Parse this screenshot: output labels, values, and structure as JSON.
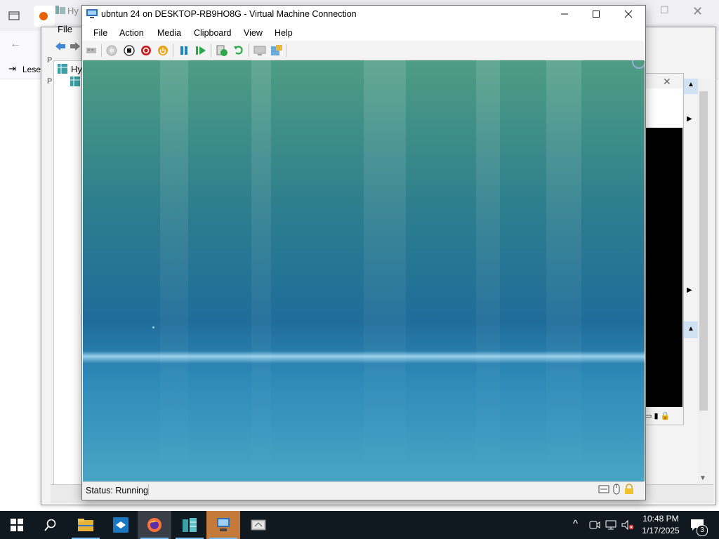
{
  "browser": {
    "bookmark_label": "Lesez",
    "tab_label": "Hy"
  },
  "hyperv_manager": {
    "menu_file": "File",
    "tree_root_label": "Hy",
    "pane_letter_1": "P",
    "pane_letter_2": "P"
  },
  "vm_window": {
    "title": "ubntun 24 on DESKTOP-RB9HO8G - Virtual Machine Connection",
    "menu": [
      "File",
      "Action",
      "Media",
      "Clipboard",
      "View",
      "Help"
    ],
    "status": "Status: Running"
  },
  "taskbar": {
    "time": "10:48 PM",
    "date": "1/17/2025",
    "notification_count": "3",
    "apps": [
      "file-explorer",
      "app-blue",
      "firefox",
      "hyperv-manager",
      "vm-connection",
      "remote-desktop"
    ]
  },
  "colors": {
    "taskbar": "#101820",
    "accent": "#0078d7",
    "vm_screen_top": "#4f9d83",
    "vm_screen_bottom": "#4aa5c4"
  }
}
